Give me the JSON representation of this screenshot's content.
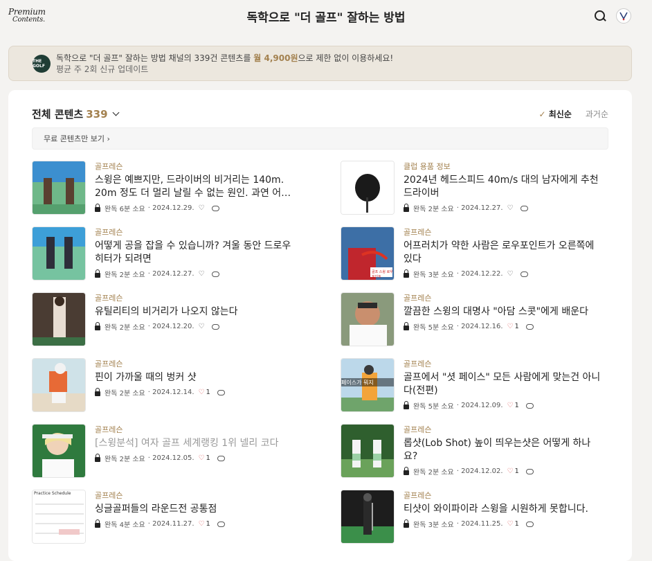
{
  "header": {
    "logo_line1": "Premium",
    "logo_line2": "Contents.",
    "title": "독학으로 \"더 골프\" 잘하는 방법"
  },
  "banner": {
    "logo_text": "THE GOLF",
    "text_prefix": "독학으로 \"더 골프\" 잘하는 방법 채널의 339건 콘텐츠를 ",
    "text_price": "월 4,900원",
    "text_suffix": "으로 제한 없이 이용하세요!",
    "sub": "평균 주 2회 신규 업데이트"
  },
  "panel": {
    "title": "전체 콘텐츠",
    "count": "339",
    "sort_active": "최신순",
    "sort_inactive": "과거순",
    "free_filter": "무료 콘텐츠만 보기 ›"
  },
  "items": [
    {
      "cat": "골프레슨",
      "title": "스윙은 예쁘지만, 드라이버의 비거리는 140m. 20m 정도 더 멀리 날릴 수 없는 원인. 과연 어…",
      "read": "완독 6분 소요",
      "date": "· 2024.12.29.",
      "likes": ""
    },
    {
      "cat": "클럽 용품 정보",
      "title": "2024년 헤드스피드 40m/s 대의 남자에게 추천 드라이버",
      "read": "완독 2분 소요",
      "date": "· 2024.12.27.",
      "likes": ""
    },
    {
      "cat": "골프레슨",
      "title": "어떻게 공을 잡을 수 있습니까? 겨울 동안 드로우 히터가 되려면",
      "read": "완독 2분 소요",
      "date": "· 2024.12.27.",
      "likes": ""
    },
    {
      "cat": "골프레슨",
      "title": "어프러치가 약한 사람은 로우포인트가 오른쪽에 있다",
      "read": "완독 3분 소요",
      "date": "· 2024.12.22.",
      "likes": ""
    },
    {
      "cat": "골프레슨",
      "title": "유틸리티의 비거리가 나오지 않는다",
      "read": "완독 2분 소요",
      "date": "· 2024.12.20.",
      "likes": ""
    },
    {
      "cat": "골프레슨",
      "title": "깔끔한 스윙의 대명사 \"아담 스콧\"에게 배운다",
      "read": "완독 5분 소요",
      "date": "· 2024.12.16.",
      "likes": "1"
    },
    {
      "cat": "골프레슨",
      "title": "핀이 가까울 때의 벙커 샷",
      "read": "완독 2분 소요",
      "date": "· 2024.12.14.",
      "likes": "1"
    },
    {
      "cat": "골프레슨",
      "title": "골프에서 \"셧 페이스\" 모든 사람에게 맞는건 아니다(전편)",
      "read": "완독 5분 소요",
      "date": "· 2024.12.09.",
      "likes": "1"
    },
    {
      "cat": "골프레슨",
      "title": "[스윙분석] 여자 골프 세계랭킹 1위 넬리 코다",
      "read": "완독 2분 소요",
      "date": "· 2024.12.05.",
      "likes": "1",
      "muted": true
    },
    {
      "cat": "골프레슨",
      "title": "롭샷(Lob Shot) 높이 띄우는샷은 어떻게 하나요?",
      "read": "완독 2분 소요",
      "date": "· 2024.12.02.",
      "likes": "1"
    },
    {
      "cat": "골프레슨",
      "title": "싱글골퍼들의 라운드전 공통점",
      "read": "완독 4분 소요",
      "date": "· 2024.11.27.",
      "likes": "1"
    },
    {
      "cat": "골프레슨",
      "title": "티샷이 와이파이라 스윙을 시원하게 못합니다.",
      "read": "완독 3분 소요",
      "date": "· 2024.11.25.",
      "likes": "1"
    }
  ],
  "thumb_captions": {
    "t4": "골프 스윙 로우포인트",
    "t8": "페이스가 뭐지",
    "t11": "Practice Schedule"
  }
}
